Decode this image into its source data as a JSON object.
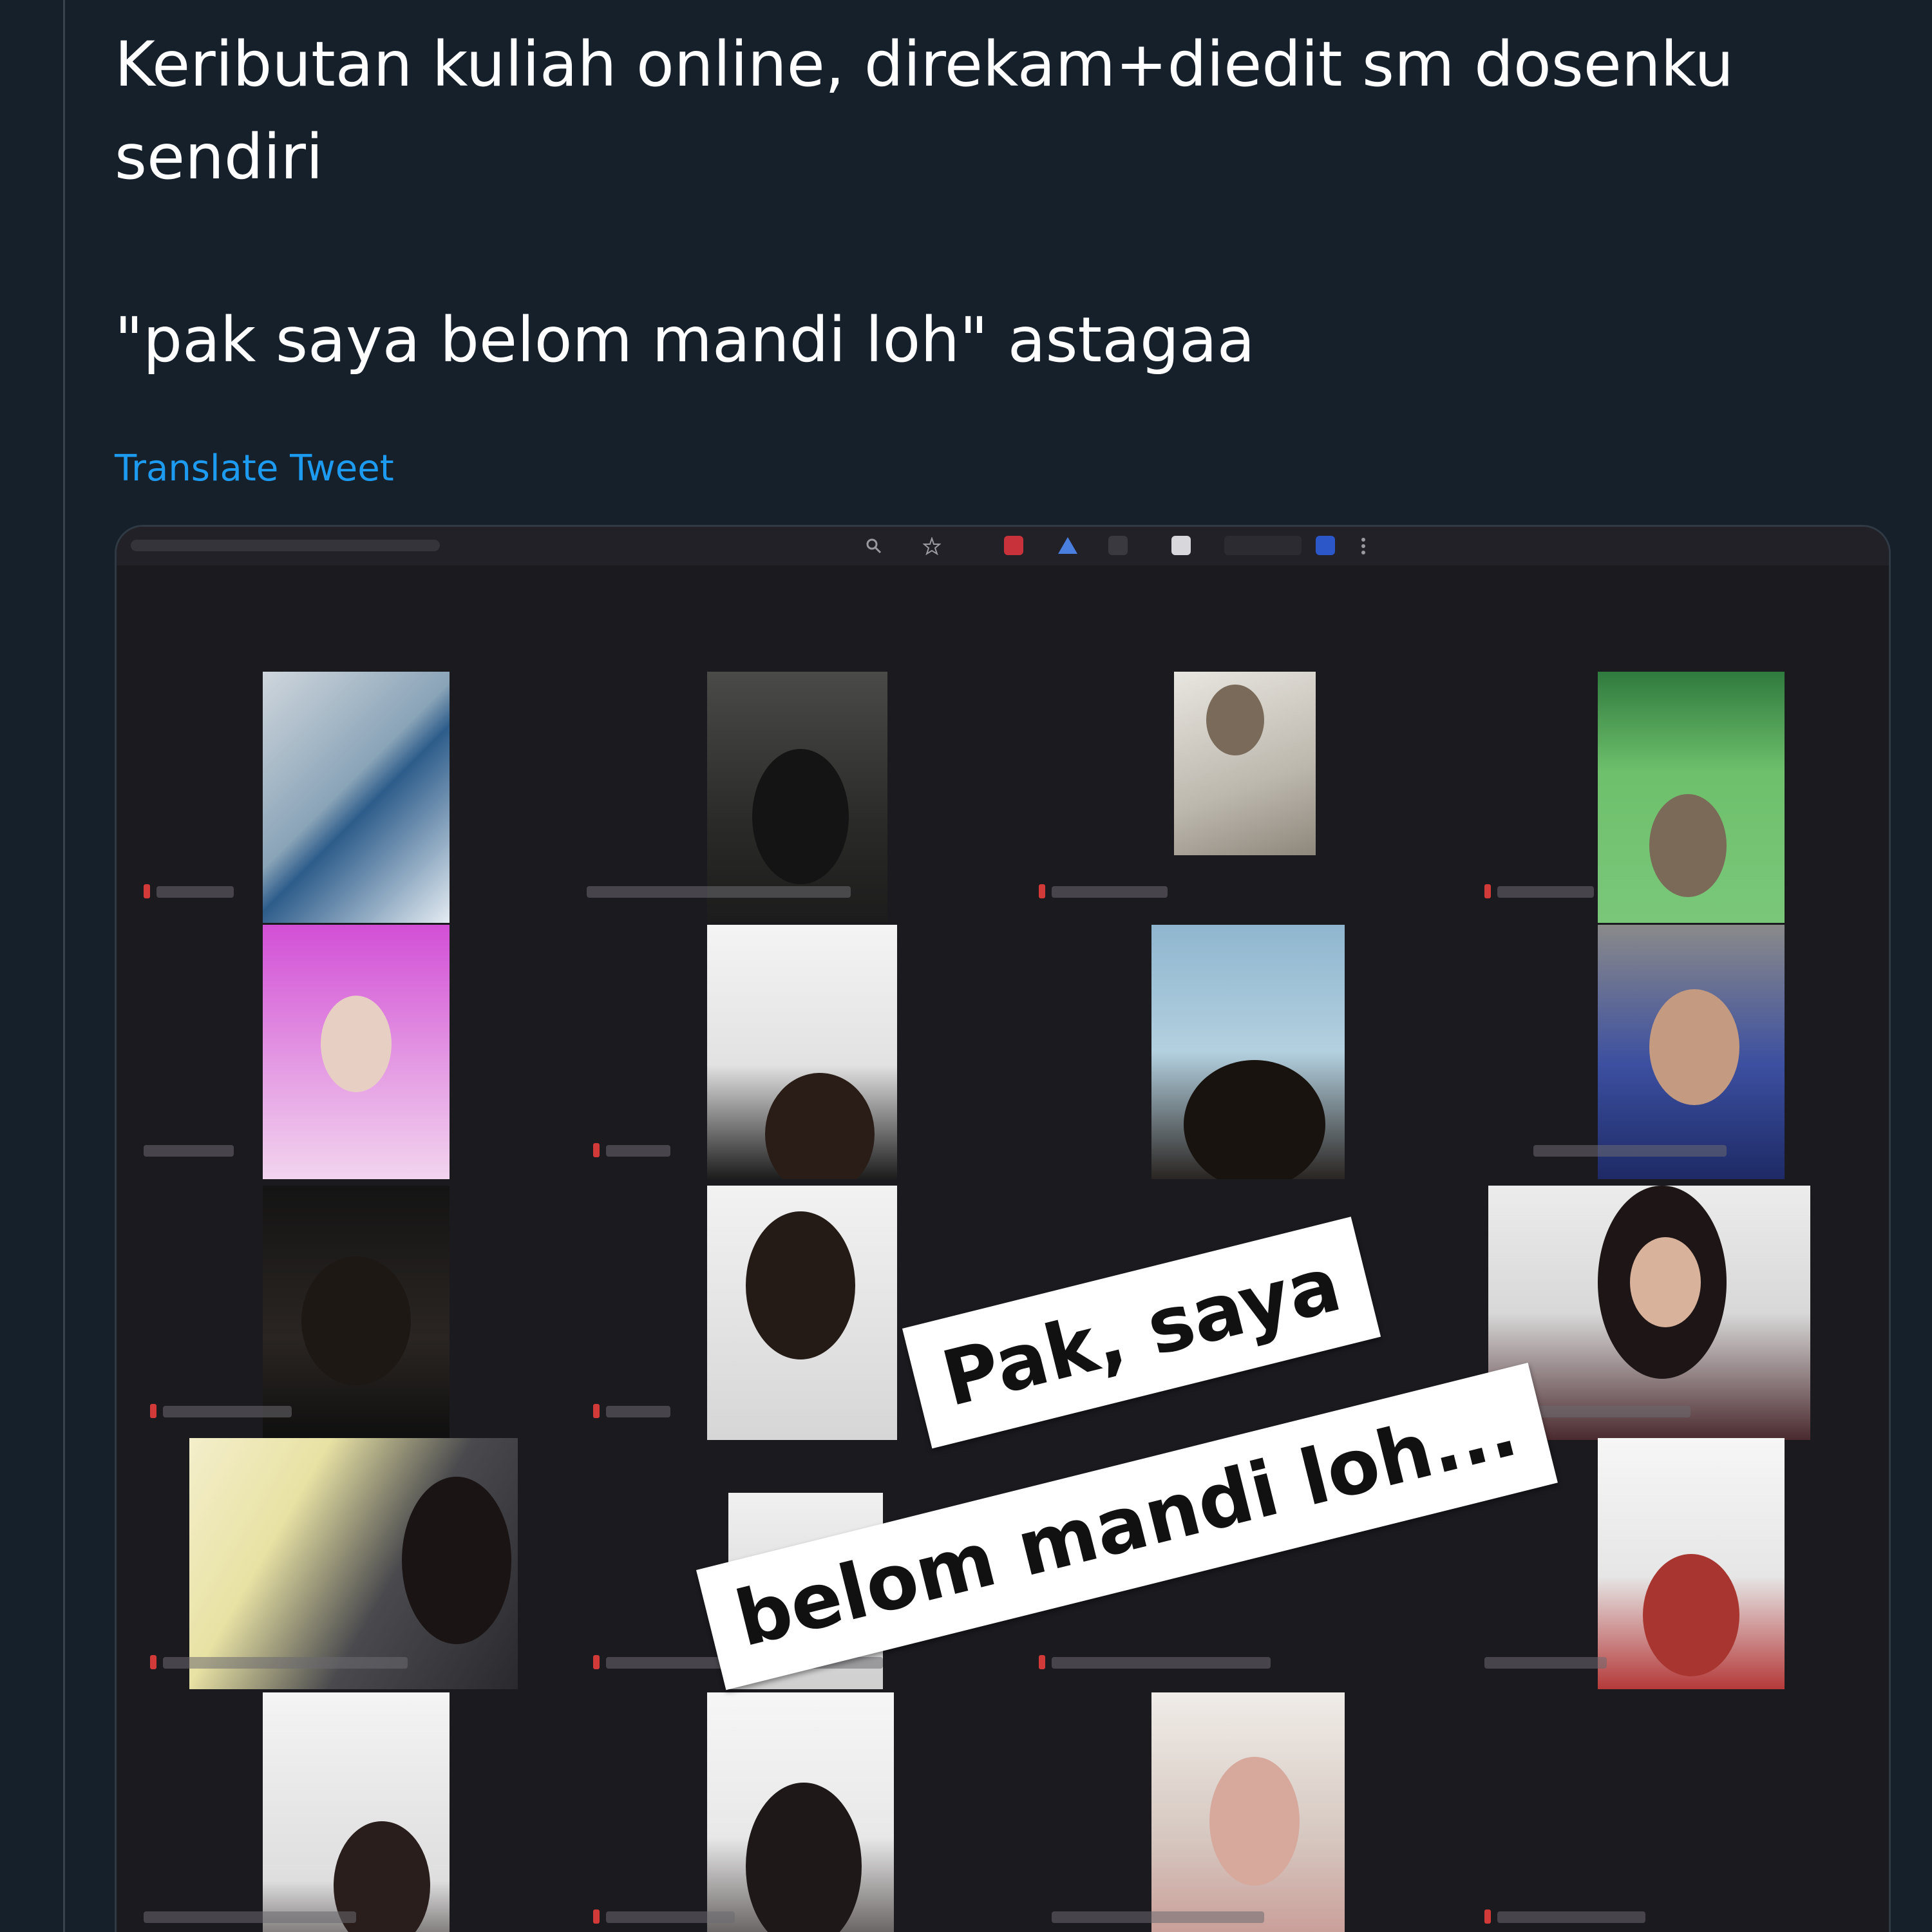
{
  "tweet": {
    "text_line_1": "Keributan kuliah online, direkam+diedit sm dosenku",
    "text_line_2": "sendiri",
    "text_line_3": "\"pak saya belom mandi loh\" astagaa",
    "translate_label": "Translate Tweet"
  },
  "video": {
    "caption_line_1": "Pak, saya",
    "caption_line_2": "belom mandi loh..."
  },
  "colors": {
    "background": "#15202b",
    "text": "#ffffff",
    "link": "#1d9bf0",
    "media_background": "#1b1a1f"
  }
}
